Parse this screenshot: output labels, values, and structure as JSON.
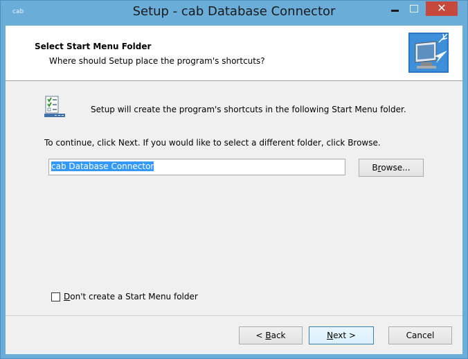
{
  "window": {
    "title": "Setup - cab Database Connector",
    "app_icon_text": "cab",
    "close_symbol": "✕"
  },
  "header": {
    "title": "Select Start Menu Folder",
    "subtitle": "Where should Setup place the program's shortcuts?"
  },
  "body": {
    "info_text": "Setup will create the program's shortcuts in the following Start Menu folder.",
    "continue_text": "To continue, click Next. If you would like to select a different folder, click Browse.",
    "folder_value": "cab Database Connector",
    "browse": {
      "pre": "B",
      "hot": "r",
      "post": "owse..."
    },
    "checkbox": {
      "checked": false,
      "hot": "D",
      "post": "on't create a Start Menu folder"
    }
  },
  "footer": {
    "back": {
      "pre": "< ",
      "hot": "B",
      "post": "ack"
    },
    "next": {
      "pre": "",
      "hot": "N",
      "post": "ext >"
    },
    "cancel": "Cancel"
  },
  "colors": {
    "titlebar": "#6badd9",
    "close": "#c7483c",
    "selection": "#3399ff"
  },
  "icons": [
    "minimize-icon",
    "maximize-icon",
    "close-icon",
    "start-menu-folder-icon",
    "setup-computer-icon"
  ]
}
